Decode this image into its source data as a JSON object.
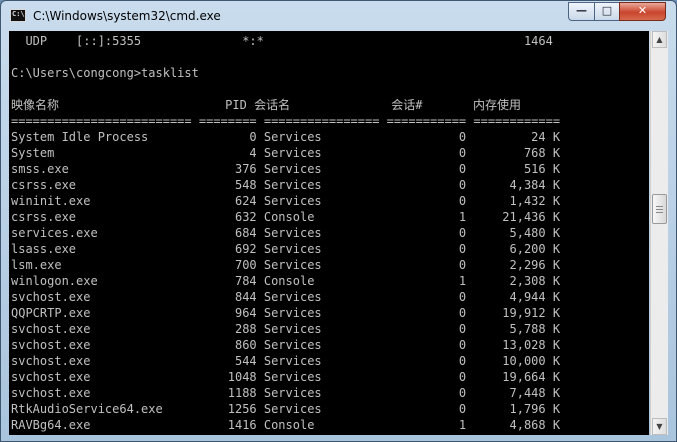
{
  "window": {
    "title": "C:\\Windows\\system32\\cmd.exe",
    "icon": "cmd-icon",
    "icon_text": "C:\\"
  },
  "buttons": {
    "minimize": "—",
    "maximize": "□",
    "close": "✕"
  },
  "scrollbar": {
    "up": "▲",
    "down": "▼"
  },
  "console": {
    "lines": [
      "  UDP    [::]:5355              *:*                                    1464",
      "",
      "C:\\Users\\congcong>tasklist",
      "",
      "映像名称                       PID 会话名              会话#       内存使用",
      "========================= ======== ================ =========== ============",
      "System Idle Process              0 Services                   0         24 K",
      "System                           4 Services                   0        768 K",
      "smss.exe                       376 Services                   0        516 K",
      "csrss.exe                      548 Services                   0      4,384 K",
      "wininit.exe                    624 Services                   0      1,432 K",
      "csrss.exe                      632 Console                    1     21,436 K",
      "services.exe                   684 Services                   0      5,480 K",
      "lsass.exe                      692 Services                   0      6,200 K",
      "lsm.exe                        700 Services                   0      2,296 K",
      "winlogon.exe                   784 Console                    1      2,308 K",
      "svchost.exe                    844 Services                   0      4,944 K",
      "QQPCRTP.exe                    964 Services                   0     19,912 K",
      "svchost.exe                    288 Services                   0      5,788 K",
      "svchost.exe                    860 Services                   0     13,028 K",
      "svchost.exe                    544 Services                   0     10,000 K",
      "svchost.exe                   1048 Services                   0     19,664 K",
      "svchost.exe                   1188 Services                   0      7,448 K",
      "RtkAudioService64.exe         1256 Services                   0      1,796 K",
      "RAVBg64.exe                   1416 Console                    1      4,868 K"
    ]
  }
}
